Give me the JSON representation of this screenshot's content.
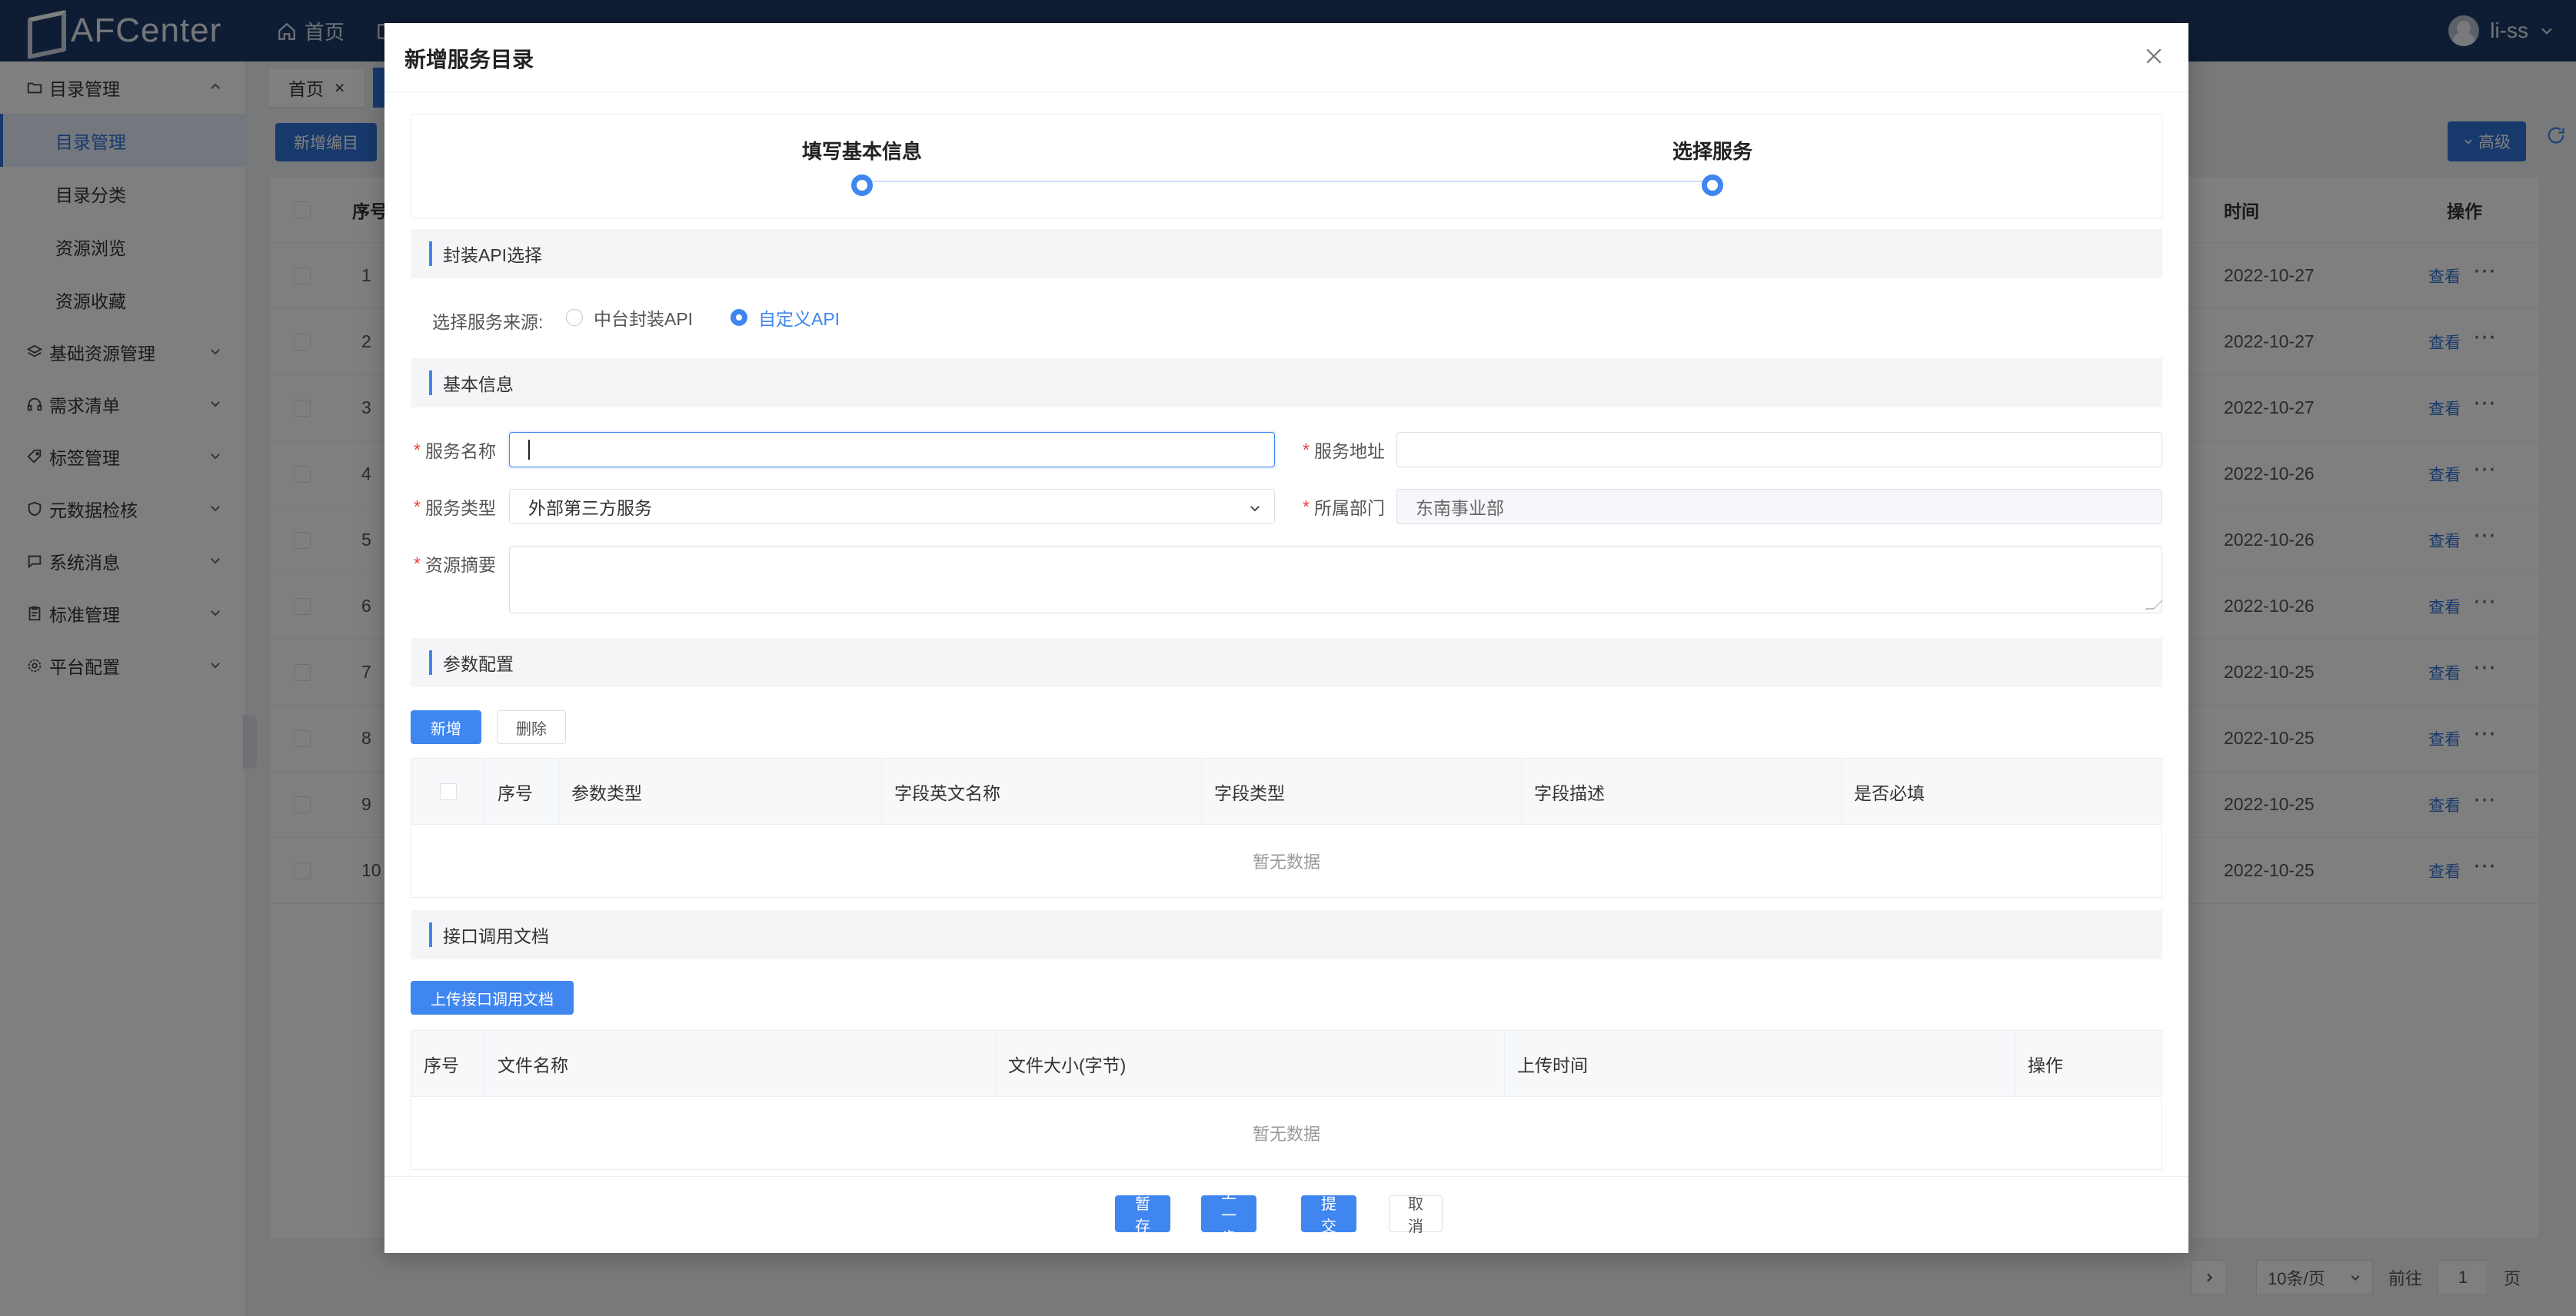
{
  "app": {
    "logo_text": "AFCenter",
    "user_name": "li-ss",
    "top_nav": [
      {
        "label": "首页",
        "icon": "home-icon"
      },
      {
        "label": "",
        "icon": "book-icon"
      }
    ]
  },
  "sidebar": {
    "groups": [
      {
        "label": "目录管理",
        "icon": "folder-icon",
        "expanded": true,
        "items": [
          "目录管理",
          "目录分类",
          "资源浏览",
          "资源收藏"
        ]
      },
      {
        "label": "基础资源管理",
        "icon": "layers-icon"
      },
      {
        "label": "需求清单",
        "icon": "headset-icon"
      },
      {
        "label": "标签管理",
        "icon": "tag-icon"
      },
      {
        "label": "元数据检核",
        "icon": "shield-icon"
      },
      {
        "label": "系统消息",
        "icon": "chat-icon"
      },
      {
        "label": "标准管理",
        "icon": "clipboard-icon"
      },
      {
        "label": "平台配置",
        "icon": "gear-icon"
      }
    ]
  },
  "content": {
    "tabs": [
      "首页"
    ],
    "new_button": "新增编目",
    "advanced_button": "高级",
    "table_headers": {
      "index": "序号",
      "time": "时间",
      "actions": "操作"
    },
    "rows": [
      {
        "index": "1",
        "time": "2022-10-27",
        "action": "查看"
      },
      {
        "index": "2",
        "time": "2022-10-27",
        "action": "查看"
      },
      {
        "index": "3",
        "time": "2022-10-27",
        "action": "查看"
      },
      {
        "index": "4",
        "time": "2022-10-26",
        "action": "查看"
      },
      {
        "index": "5",
        "time": "2022-10-26",
        "action": "查看"
      },
      {
        "index": "6",
        "time": "2022-10-26",
        "action": "查看"
      },
      {
        "index": "7",
        "time": "2022-10-25",
        "action": "查看"
      },
      {
        "index": "8",
        "time": "2022-10-25",
        "action": "查看"
      },
      {
        "index": "9",
        "time": "2022-10-25",
        "action": "查看"
      },
      {
        "index": "10",
        "time": "2022-10-25",
        "action": "查看"
      }
    ],
    "pagination": {
      "page_size": "10条/页",
      "goto_prefix": "前往",
      "page": "1",
      "goto_suffix": "页"
    }
  },
  "dialog": {
    "title": "新增服务目录",
    "steps": [
      "填写基本信息",
      "选择服务"
    ],
    "sections": {
      "api": "封装API选择",
      "basic": "基本信息",
      "params": "参数配置",
      "docs": "接口调用文档"
    },
    "source": {
      "label": "选择服务来源:",
      "options": [
        "中台封装API",
        "自定义API"
      ],
      "selected": "自定义API"
    },
    "form": {
      "service_name_label": "服务名称",
      "service_name_value": "",
      "service_addr_label": "服务地址",
      "service_addr_value": "",
      "service_type_label": "服务类型",
      "service_type_value": "外部第三方服务",
      "department_label": "所属部门",
      "department_value": "东南事业部",
      "summary_label": "资源摘要",
      "required_mark": "*"
    },
    "params": {
      "add_button": "新增",
      "delete_button": "删除",
      "columns": [
        "序号",
        "参数类型",
        "字段英文名称",
        "字段类型",
        "字段描述",
        "是否必填"
      ],
      "empty_text": "暂无数据"
    },
    "docs": {
      "upload_button": "上传接口调用文档",
      "columns": [
        "序号",
        "文件名称",
        "文件大小(字节)",
        "上传时间",
        "操作"
      ],
      "empty_text": "暂无数据"
    },
    "footer": {
      "save_draft": "暂存",
      "prev_step": "上一步",
      "submit": "提交",
      "cancel": "取消"
    }
  }
}
